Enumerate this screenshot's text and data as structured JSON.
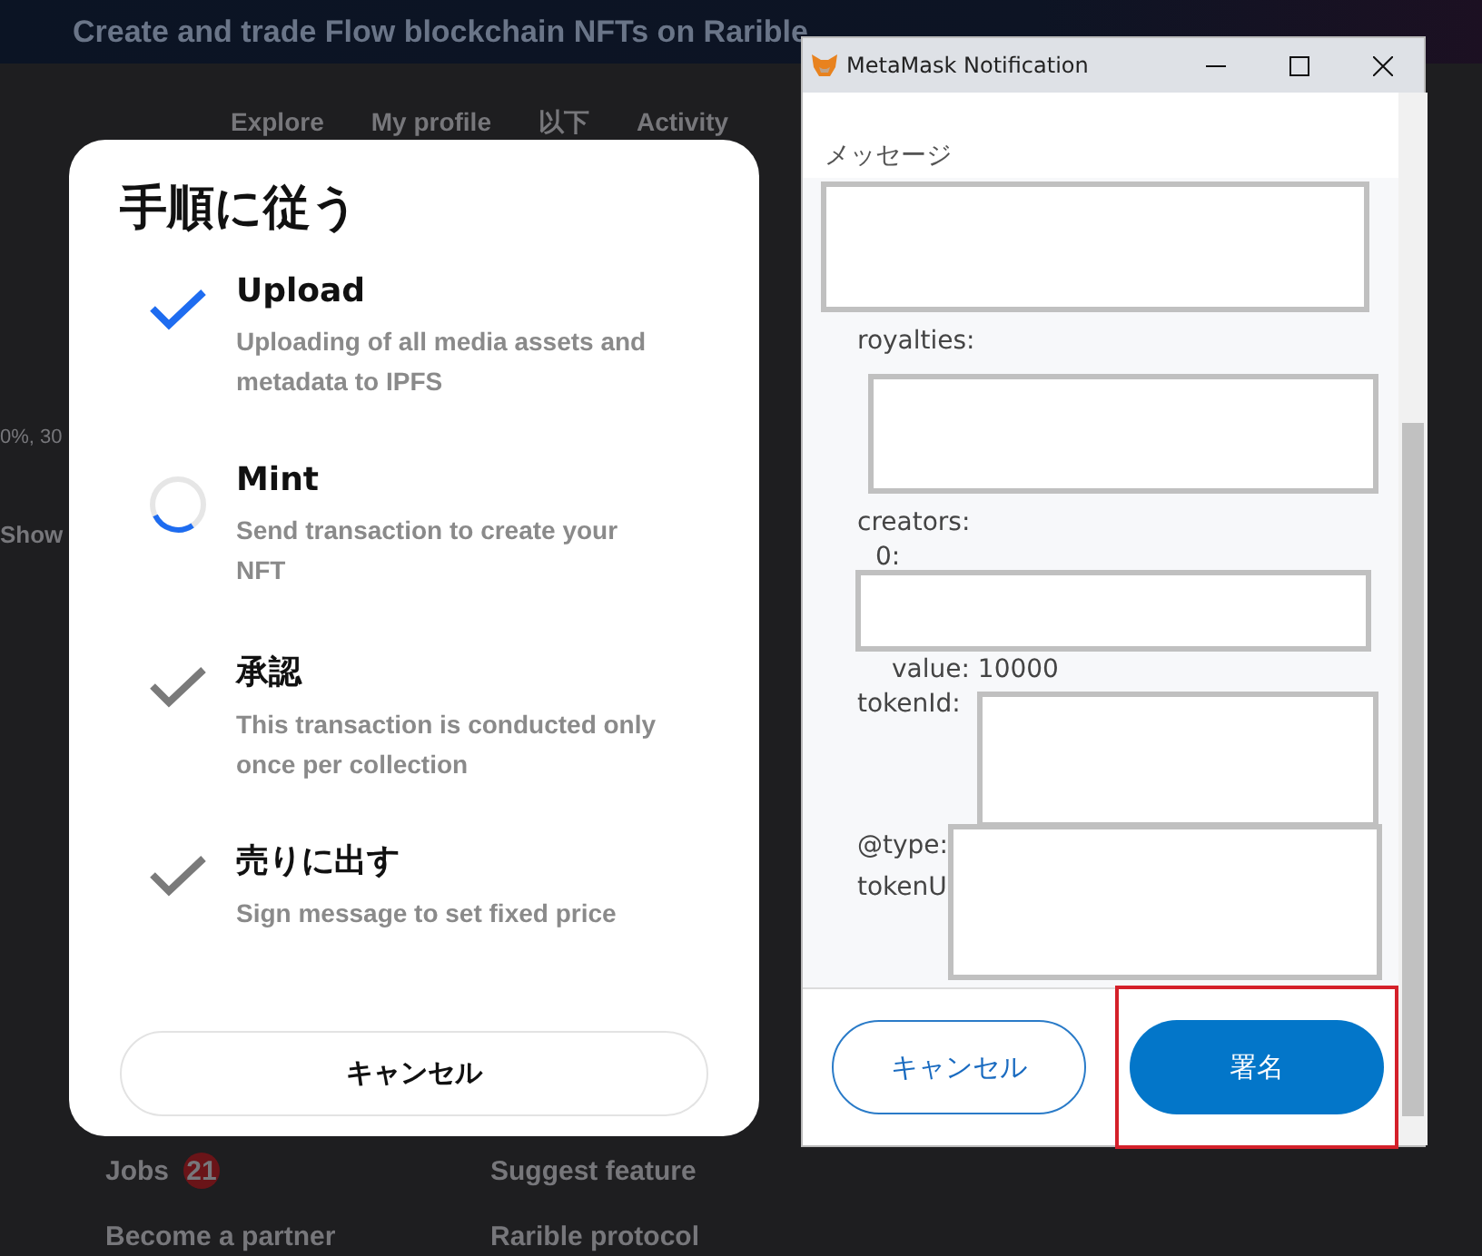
{
  "background_page": {
    "banner": "Create and trade Flow blockchain NFTs on Rarible",
    "nav": [
      "Explore",
      "My profile",
      "以下",
      "Activity"
    ],
    "left_fragments": [
      "0%, 30",
      "Show"
    ],
    "footer_links": [
      {
        "label": "Jobs",
        "badge": "21"
      },
      {
        "label": "Suggest feature"
      },
      {
        "label": "Become a partner"
      },
      {
        "label": "Rarible protocol"
      }
    ]
  },
  "steps_modal": {
    "title": "手順に従う",
    "steps": [
      {
        "title": "Upload",
        "description": "Uploading of all media assets and metadata to IPFS",
        "done": true,
        "in_progress": false
      },
      {
        "title": "Mint",
        "description": "Send transaction to create your NFT",
        "done": false,
        "in_progress": true
      },
      {
        "title": "承認",
        "description": "This transaction is conducted only once per collection",
        "done": false,
        "in_progress": false
      },
      {
        "title": "売りに出す",
        "description": "Sign message to set fixed price",
        "done": false,
        "in_progress": false
      }
    ],
    "cancel_button": "キャンセル"
  },
  "metamask_window": {
    "title": "MetaMask Notification",
    "message_label": "メッセージ",
    "message_lines": [
      "royalties:",
      "creators:",
      "0:",
      "value: 10000",
      "tokenId:",
      "@type:",
      "tokenU"
    ],
    "cancel_button": "キャンセル",
    "sign_button": "署名",
    "sign_highlighted": true
  }
}
